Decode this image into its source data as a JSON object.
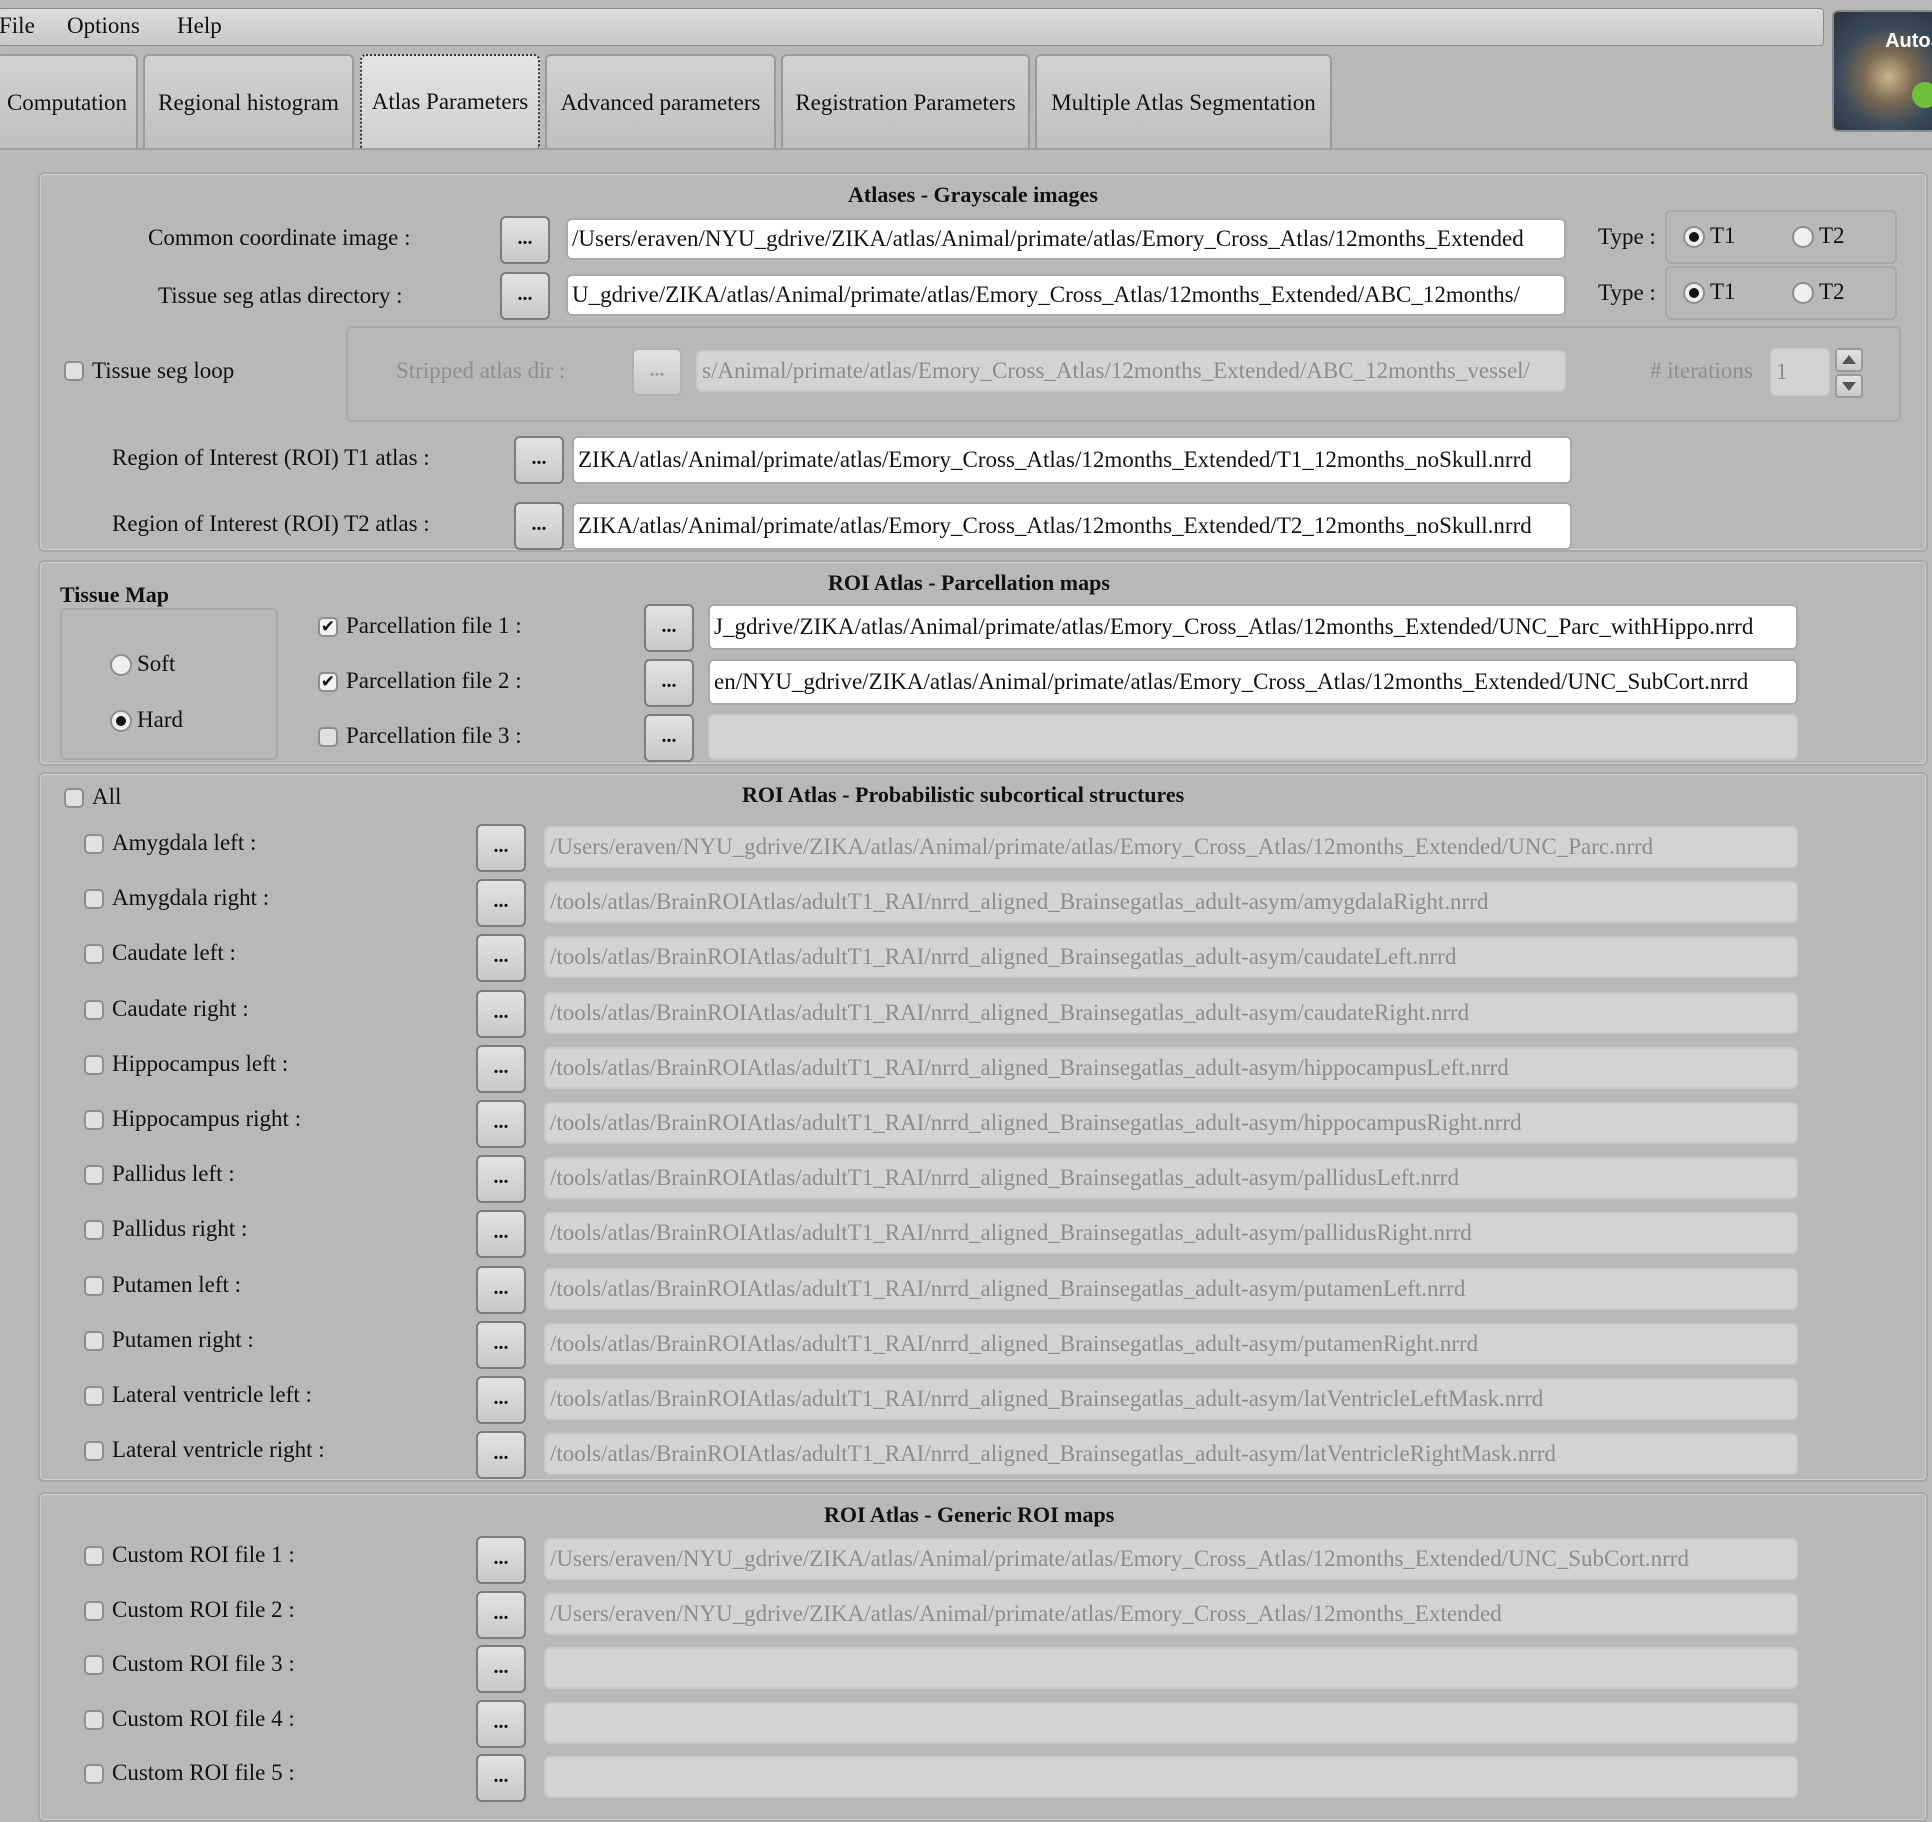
{
  "menu": {
    "file": "File",
    "options": "Options",
    "help": "Help"
  },
  "logo": {
    "text": "AutoS"
  },
  "tabs": [
    {
      "label": "Computation"
    },
    {
      "label": "Regional histogram"
    },
    {
      "label": "Atlas Parameters"
    },
    {
      "label": "Advanced parameters"
    },
    {
      "label": "Registration Parameters"
    },
    {
      "label": "Multiple Atlas Segmentation"
    }
  ],
  "atlases": {
    "title": "Atlases - Grayscale images",
    "common_label": "Common coordinate image :",
    "common_value": "/Users/eraven/NYU_gdrive/ZIKA/atlas/Animal/primate/atlas/Emory_Cross_Atlas/12months_Extended",
    "tissue_label": "Tissue seg atlas directory :",
    "tissue_value": "U_gdrive/ZIKA/atlas/Animal/primate/atlas/Emory_Cross_Atlas/12months_Extended/ABC_12months/",
    "type_label": "Type :",
    "t1": "T1",
    "t2": "T2",
    "loop_label": "Tissue seg loop",
    "stripped_label": "Stripped atlas dir :",
    "stripped_value": "s/Animal/primate/atlas/Emory_Cross_Atlas/12months_Extended/ABC_12months_vessel/",
    "iterations_label": "# iterations",
    "iterations_value": "1",
    "roi_t1_label": "Region of Interest (ROI) T1 atlas :",
    "roi_t1_value": "ZIKA/atlas/Animal/primate/atlas/Emory_Cross_Atlas/12months_Extended/T1_12months_noSkull.nrrd",
    "roi_t2_label": "Region of Interest (ROI) T2 atlas :",
    "roi_t2_value": "ZIKA/atlas/Animal/primate/atlas/Emory_Cross_Atlas/12months_Extended/T2_12months_noSkull.nrrd",
    "browse": "..."
  },
  "parcellation": {
    "title": "ROI Atlas - Parcellation maps",
    "tissue_map_label": "Tissue Map",
    "soft": "Soft",
    "hard": "Hard",
    "files": [
      {
        "label": "Parcellation file 1 :",
        "value": "J_gdrive/ZIKA/atlas/Animal/primate/atlas/Emory_Cross_Atlas/12months_Extended/UNC_Parc_withHippo.nrrd"
      },
      {
        "label": "Parcellation file 2 :",
        "value": "en/NYU_gdrive/ZIKA/atlas/Animal/primate/atlas/Emory_Cross_Atlas/12months_Extended/UNC_SubCort.nrrd"
      },
      {
        "label": "Parcellation file 3 :",
        "value": ""
      }
    ]
  },
  "subcortical": {
    "title": "ROI Atlas - Probabilistic subcortical structures",
    "all_label": "All",
    "items": [
      {
        "label": "Amygdala left :",
        "value": "/Users/eraven/NYU_gdrive/ZIKA/atlas/Animal/primate/atlas/Emory_Cross_Atlas/12months_Extended/UNC_Parc.nrrd"
      },
      {
        "label": "Amygdala right :",
        "value": "/tools/atlas/BrainROIAtlas/adultT1_RAI/nrrd_aligned_Brainsegatlas_adult-asym/amygdalaRight.nrrd"
      },
      {
        "label": "Caudate left :",
        "value": "/tools/atlas/BrainROIAtlas/adultT1_RAI/nrrd_aligned_Brainsegatlas_adult-asym/caudateLeft.nrrd"
      },
      {
        "label": "Caudate right :",
        "value": "/tools/atlas/BrainROIAtlas/adultT1_RAI/nrrd_aligned_Brainsegatlas_adult-asym/caudateRight.nrrd"
      },
      {
        "label": "Hippocampus left :",
        "value": "/tools/atlas/BrainROIAtlas/adultT1_RAI/nrrd_aligned_Brainsegatlas_adult-asym/hippocampusLeft.nrrd"
      },
      {
        "label": "Hippocampus right :",
        "value": "/tools/atlas/BrainROIAtlas/adultT1_RAI/nrrd_aligned_Brainsegatlas_adult-asym/hippocampusRight.nrrd"
      },
      {
        "label": "Pallidus left :",
        "value": "/tools/atlas/BrainROIAtlas/adultT1_RAI/nrrd_aligned_Brainsegatlas_adult-asym/pallidusLeft.nrrd"
      },
      {
        "label": "Pallidus right :",
        "value": "/tools/atlas/BrainROIAtlas/adultT1_RAI/nrrd_aligned_Brainsegatlas_adult-asym/pallidusRight.nrrd"
      },
      {
        "label": "Putamen left :",
        "value": "/tools/atlas/BrainROIAtlas/adultT1_RAI/nrrd_aligned_Brainsegatlas_adult-asym/putamenLeft.nrrd"
      },
      {
        "label": "Putamen right :",
        "value": "/tools/atlas/BrainROIAtlas/adultT1_RAI/nrrd_aligned_Brainsegatlas_adult-asym/putamenRight.nrrd"
      },
      {
        "label": "Lateral ventricle left :",
        "value": "/tools/atlas/BrainROIAtlas/adultT1_RAI/nrrd_aligned_Brainsegatlas_adult-asym/latVentricleLeftMask.nrrd"
      },
      {
        "label": "Lateral ventricle right :",
        "value": "/tools/atlas/BrainROIAtlas/adultT1_RAI/nrrd_aligned_Brainsegatlas_adult-asym/latVentricleRightMask.nrrd"
      }
    ]
  },
  "generic": {
    "title": "ROI Atlas - Generic ROI maps",
    "items": [
      {
        "label": "Custom ROI file 1 :",
        "value": "/Users/eraven/NYU_gdrive/ZIKA/atlas/Animal/primate/atlas/Emory_Cross_Atlas/12months_Extended/UNC_SubCort.nrrd"
      },
      {
        "label": "Custom ROI file 2 :",
        "value": "/Users/eraven/NYU_gdrive/ZIKA/atlas/Animal/primate/atlas/Emory_Cross_Atlas/12months_Extended"
      },
      {
        "label": "Custom ROI file 3 :",
        "value": ""
      },
      {
        "label": "Custom ROI file 4 :",
        "value": ""
      },
      {
        "label": "Custom ROI file 5 :",
        "value": ""
      }
    ]
  }
}
